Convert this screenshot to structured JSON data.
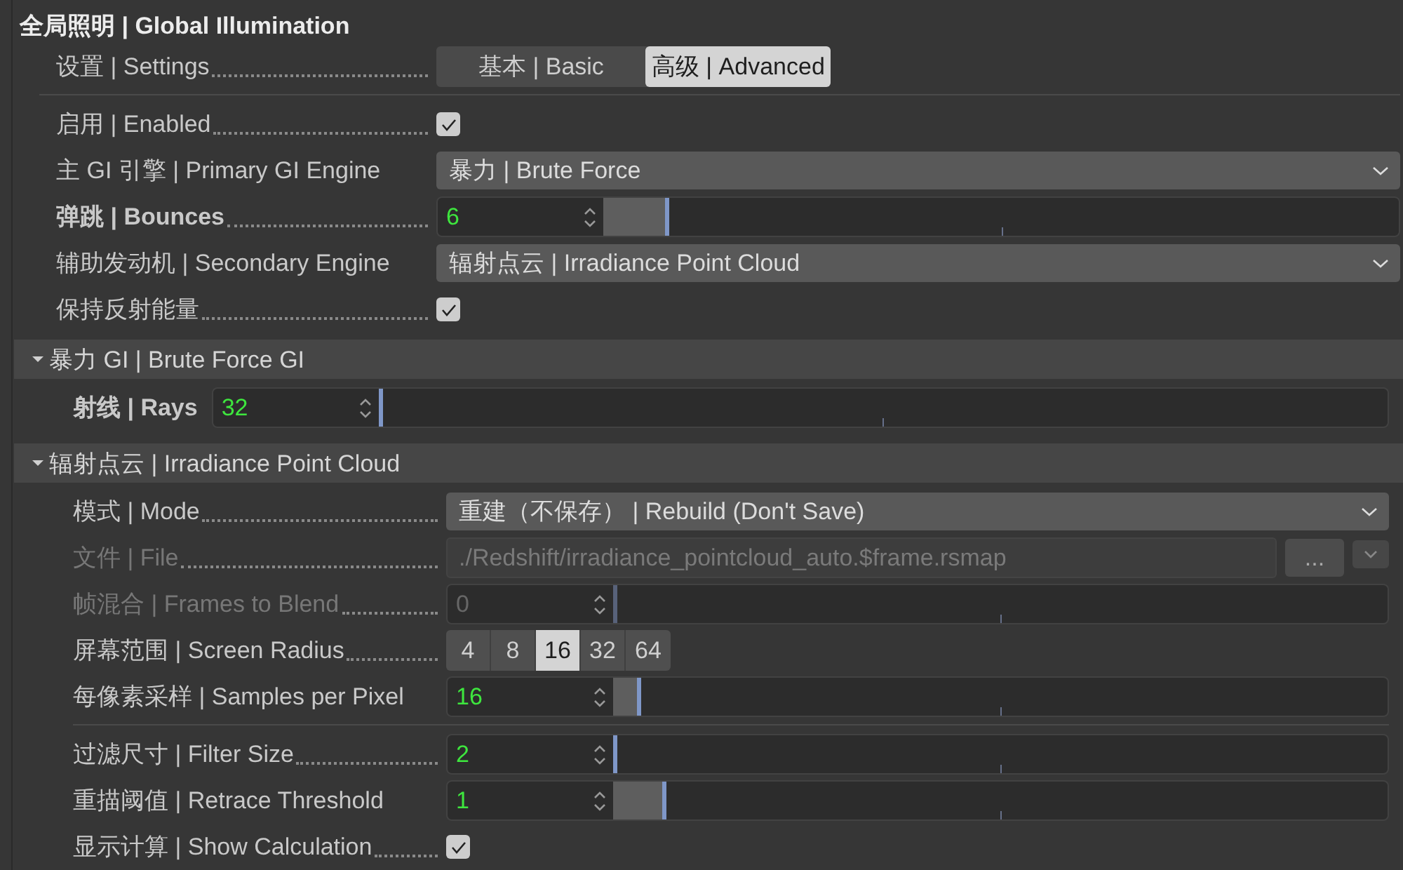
{
  "title": "全局照明 | Global Illumination",
  "main": {
    "rows": [
      {
        "kind": "tabs",
        "label": "设置 | Settings",
        "leader": true,
        "tabs": [
          {
            "label": "基本 | Basic",
            "selected": false
          },
          {
            "label": "高级 | Advanced",
            "selected": true
          }
        ]
      },
      {
        "kind": "divider"
      },
      {
        "kind": "checkbox",
        "label": "启用 | Enabled",
        "leader": true,
        "checked": true
      },
      {
        "kind": "dropdown",
        "label": "主 GI 引擎 | Primary GI Engine",
        "leader": false,
        "value": "暴力 | Brute Force"
      },
      {
        "kind": "slider",
        "label": "弹跳 | Bounces",
        "leader": true,
        "bold": true,
        "value": "6",
        "level": 0.078
      },
      {
        "kind": "dropdown",
        "label": "辅助发动机 | Secondary Engine",
        "leader": false,
        "value": "辐射点云 | Irradiance Point Cloud"
      },
      {
        "kind": "checkbox",
        "label": "保持反射能量",
        "leader": true,
        "checked": true
      }
    ]
  },
  "sections": [
    {
      "title": "暴力 GI | Brute Force GI",
      "expanded": true,
      "rows": [
        {
          "kind": "slider",
          "label": "射线 | Rays",
          "leader": false,
          "bold": true,
          "value": "32",
          "level": 0
        }
      ]
    },
    {
      "title": "辐射点云 | Irradiance Point Cloud",
      "expanded": true,
      "rows": [
        {
          "kind": "dropdown",
          "label": "模式 | Mode",
          "leader": true,
          "value": "重建（不保存） | Rebuild (Don't Save)"
        },
        {
          "kind": "file",
          "label": "文件 | File",
          "leader": true,
          "disabled": true,
          "value": "./Redshift/irradiance_pointcloud_auto.$frame.rsmap",
          "button": "..."
        },
        {
          "kind": "slider",
          "label": "帧混合 | Frames to Blend",
          "leader": true,
          "disabled": true,
          "value": "0",
          "level": 0
        },
        {
          "kind": "segmented",
          "label": "屏幕范围 | Screen Radius",
          "leader": true,
          "options": [
            {
              "label": "4",
              "selected": false
            },
            {
              "label": "8",
              "selected": false
            },
            {
              "label": "16",
              "selected": true
            },
            {
              "label": "32",
              "selected": false
            },
            {
              "label": "64",
              "selected": false
            }
          ]
        },
        {
          "kind": "slider",
          "label": "每像素采样 | Samples per Pixel",
          "leader": false,
          "value": "16",
          "level": 0.03
        },
        {
          "kind": "divider"
        },
        {
          "kind": "slider",
          "label": "过滤尺寸 | Filter Size",
          "leader": true,
          "value": "2",
          "level": 0
        },
        {
          "kind": "slider",
          "label": "重描阈值 | Retrace Threshold",
          "leader": false,
          "value": "1",
          "level": 0.064
        },
        {
          "kind": "checkbox",
          "label": "显示计算 | Show Calculation",
          "leader": true,
          "checked": true
        }
      ]
    }
  ]
}
